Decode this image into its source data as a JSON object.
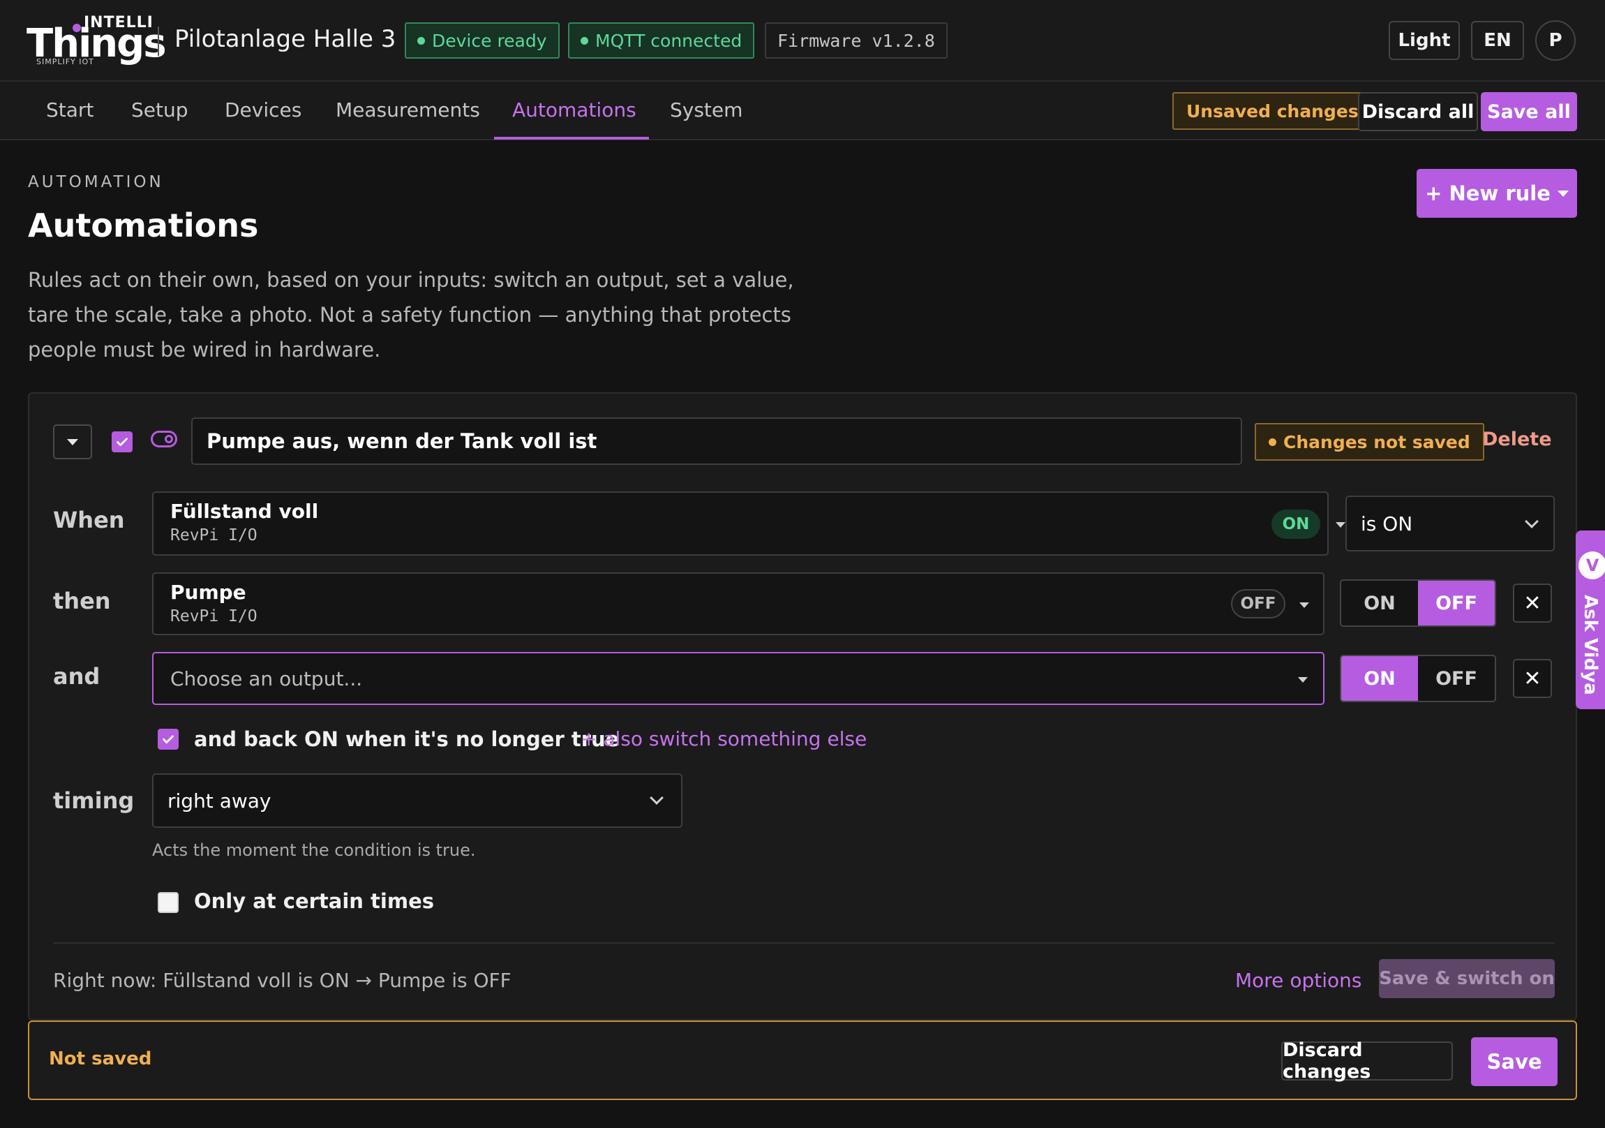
{
  "header": {
    "logo_top": "INTELLI",
    "logo_main": "Things",
    "logo_tagline": "SIMPLIFY IOT",
    "site_title": "Pilotanlage Halle 3",
    "status_device": "Device ready",
    "status_mqtt": "MQTT connected",
    "firmware": "Firmware v1.2.8",
    "theme_button": "Light",
    "lang_button": "EN",
    "avatar_initial": "P"
  },
  "nav": {
    "tabs": [
      "Start",
      "Setup",
      "Devices",
      "Measurements",
      "Automations",
      "System"
    ],
    "active_tab": "Automations",
    "unsaved_badge": "Unsaved changes",
    "discard_all": "Discard all",
    "save_all": "Save all"
  },
  "page": {
    "kicker": "AUTOMATION",
    "title": "Automations",
    "description": "Rules act on their own, based on your inputs: switch an output, set a value, tare the scale, take a photo. Not a safety function — anything that protects people must be wired in hardware.",
    "new_rule": "+ New rule"
  },
  "rule": {
    "enabled": true,
    "name": "Pumpe aus, wenn der Tank voll ist",
    "unsaved_badge": "Changes not saved",
    "delete": "Delete",
    "when": {
      "label": "When",
      "input_name": "Füllstand voll",
      "input_source": "RevPi I/O",
      "input_state": "ON",
      "condition": "is ON"
    },
    "then": {
      "label": "then",
      "output_name": "Pumpe",
      "output_source": "RevPi I/O",
      "output_state": "OFF",
      "seg_on": "ON",
      "seg_off": "OFF",
      "selected": "OFF"
    },
    "and": {
      "label": "and",
      "placeholder": "Choose an output...",
      "seg_on": "ON",
      "seg_off": "OFF",
      "selected": "ON"
    },
    "revert_checked": true,
    "revert_text": "and back ON when it's no longer true",
    "add_output_link": "+ also switch something else",
    "timing": {
      "label": "timing",
      "value": "right away",
      "hint": "Acts the moment the condition is true."
    },
    "certain_times_checked": false,
    "certain_times_text": "Only at certain times",
    "status_line": "Right now: Füllstand voll is ON → Pumpe is OFF",
    "more_options": "More options",
    "save_switch_on": "Save & switch on"
  },
  "savebar": {
    "status": "Not saved",
    "discard": "Discard changes",
    "save": "Save"
  },
  "assistant": {
    "avatar": "V",
    "label": "Ask Vidya"
  },
  "colors": {
    "accent": "#b55ce0",
    "warning": "#f0b050",
    "success": "#5fd89a",
    "danger": "#ef9a8a",
    "background": "#131313"
  }
}
